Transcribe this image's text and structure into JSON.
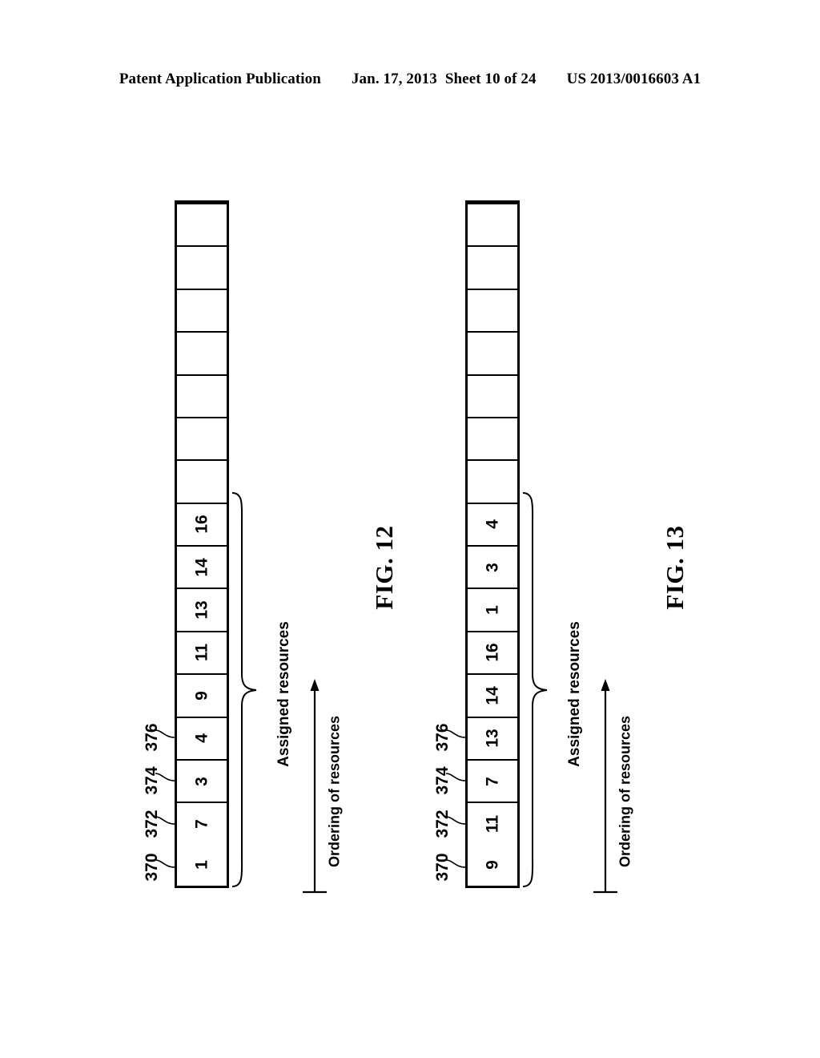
{
  "header": {
    "publication": "Patent Application Publication",
    "date": "Jan. 17, 2013",
    "sheet": "Sheet 10 of 24",
    "doc_number": "US 2013/0016603 A1"
  },
  "figures": [
    {
      "id": "fig-12",
      "caption": "FIG. 12",
      "total_cells": 16,
      "cells": [
        "1",
        "7",
        "3",
        "4",
        "9",
        "11",
        "13",
        "14",
        "16",
        "",
        "",
        "",
        "",
        "",
        "",
        ""
      ],
      "reference_numerals": [
        "370",
        "372",
        "374",
        "376"
      ],
      "assigned_label": "Assigned resources",
      "ordering_label": "Ordering of resources"
    },
    {
      "id": "fig-13",
      "caption": "FIG. 13",
      "total_cells": 16,
      "cells": [
        "9",
        "11",
        "7",
        "13",
        "14",
        "16",
        "1",
        "3",
        "4",
        "",
        "",
        "",
        "",
        "",
        "",
        ""
      ],
      "reference_numerals": [
        "370",
        "372",
        "374",
        "376"
      ],
      "assigned_label": "Assigned resources",
      "ordering_label": "Ordering of resources"
    }
  ]
}
